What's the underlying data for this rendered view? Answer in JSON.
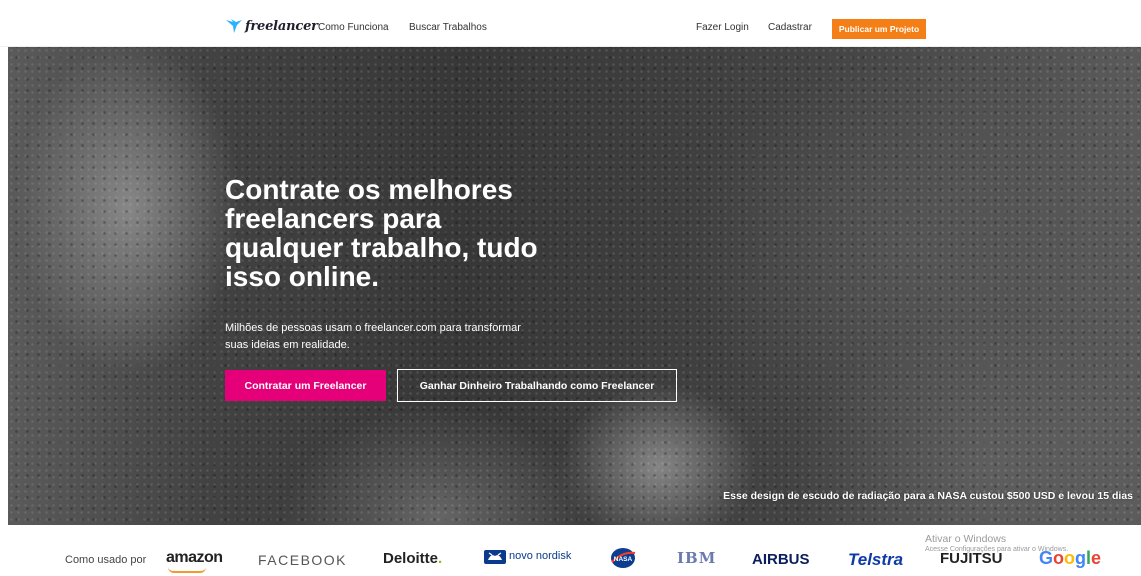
{
  "header": {
    "logo_text": "freelancer",
    "nav": {
      "how_it_works": "Como Funciona",
      "browse_jobs": "Buscar Trabalhos",
      "login": "Fazer Login",
      "signup": "Cadastrar"
    },
    "post_project": "Publicar um Projeto"
  },
  "hero": {
    "title": "Contrate os melhores freelancers para qualquer trabalho, tudo isso online.",
    "subtitle": "Milhões de pessoas usam o freelancer.com para transformar suas ideias em realidade.",
    "hire_button": "Contratar um Freelancer",
    "earn_button": "Ganhar Dinheiro Trabalhando como Freelancer",
    "caption": "Esse design de escudo de radiação para a NASA custou $500 USD e levou 15 dias"
  },
  "logos": {
    "label": "Como usado por",
    "brands": {
      "amazon": "amazon",
      "facebook": "FACEBOOK",
      "deloitte": "Deloitte",
      "deloitte_dot": ".",
      "novo_nordisk": "novo nordisk",
      "nasa": "NASA",
      "ibm": "IBM",
      "airbus": "AIRBUS",
      "telstra": "Telstra",
      "fujitsu": "FUJITSU",
      "google": "Google"
    }
  },
  "watermark": {
    "title": "Ativar o Windows",
    "subtitle": "Acesse Configurações para ativar o Windows."
  },
  "colors": {
    "brand_orange": "#f57f17",
    "brand_pink": "#e5007a",
    "logo_blue": "#29b2fe"
  }
}
